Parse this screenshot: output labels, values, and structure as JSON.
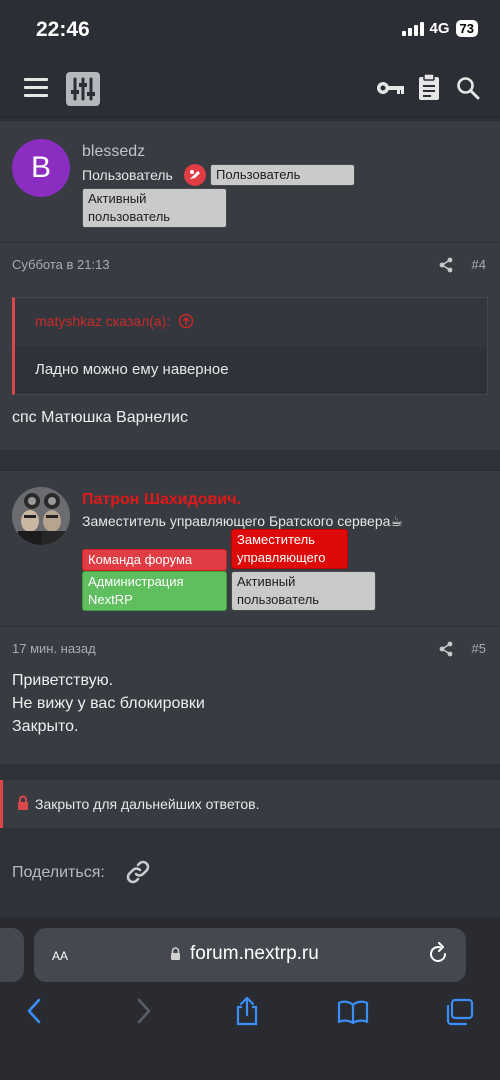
{
  "status": {
    "time": "22:46",
    "network": "4G",
    "battery": "73"
  },
  "header": {
    "menu_icon": "hamburger-icon",
    "logo_icon": "sliders-logo-icon",
    "icons": [
      "key-icon",
      "clipboard-icon",
      "search-icon"
    ]
  },
  "posts": [
    {
      "avatar_letter": "B",
      "username": "blessedz",
      "title": "Пользователь",
      "badges": [
        "Пользователь",
        "Активный пользователь"
      ],
      "date": "Суббота в 21:13",
      "number": "#4",
      "quote": {
        "author": "matyshkaz сказал(а):",
        "text": "Ладно можно ему наверное"
      },
      "text": "спс Матюшка Варнелис"
    },
    {
      "username": "Патрон Шахидович.",
      "title": "Заместитель управляющего Братского сервера☕",
      "badges": [
        "Команда форума",
        "Заместитель управляющего",
        "Администрация NextRP",
        "Активный пользователь"
      ],
      "date": "17 мин. назад",
      "number": "#5",
      "text": "Приветствую.\nНе вижу у вас блокировки\nЗакрыто."
    }
  ],
  "closed": {
    "text": "Закрыто для дальнейших ответов."
  },
  "share": {
    "label": "Поделиться:"
  },
  "browser": {
    "aa": "AA",
    "url": "forum.nextrp.ru"
  },
  "colors": {
    "accent": "#d94848",
    "user_purple": "#8c2dc2",
    "staff_red": "#e01818"
  }
}
